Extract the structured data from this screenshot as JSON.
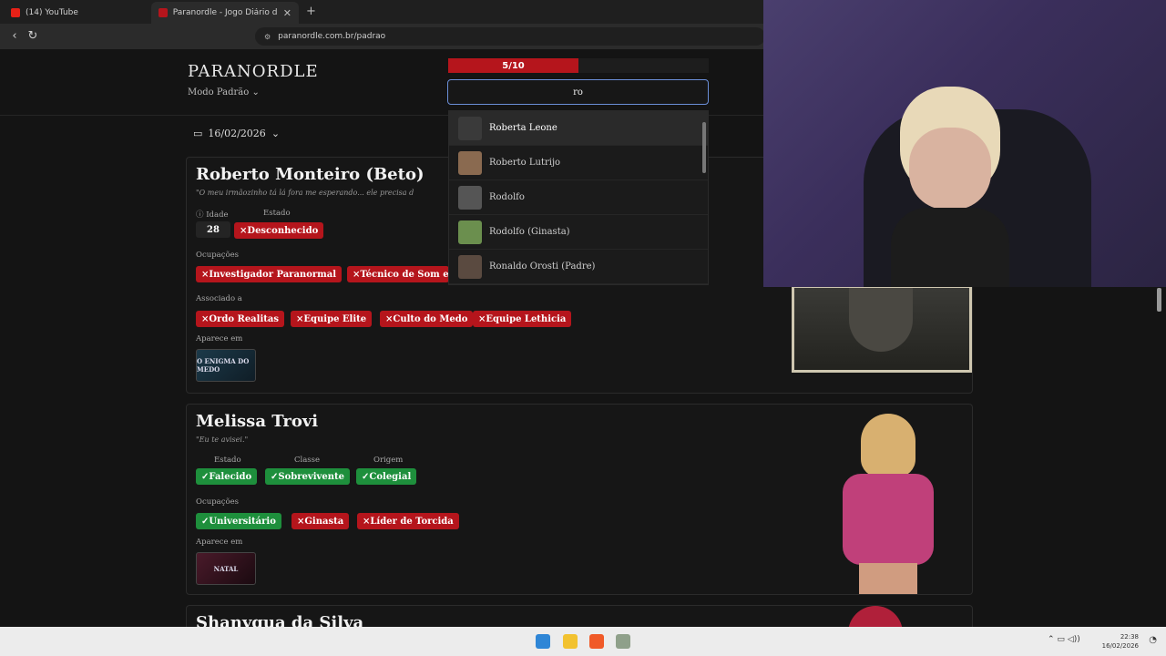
{
  "browser": {
    "tabs": [
      {
        "label": "(14) YouTube",
        "color": "#e62117"
      },
      {
        "label": "Paranordle - Jogo Diário de Ord",
        "color": "#b5151c"
      }
    ],
    "url": "paranordle.com.br/padrao"
  },
  "header": {
    "logo": "PARANORDLE",
    "mode": "Modo Padrão",
    "progress": {
      "label": "5/10",
      "fraction": 0.5
    },
    "guess_value": "ro",
    "date": "16/02/2026"
  },
  "dropdown": {
    "options": [
      {
        "name": "Roberta Leone",
        "avatar": "#3a3a3a"
      },
      {
        "name": "Roberto Lutrijo",
        "avatar": "#8a6a50"
      },
      {
        "name": "Rodolfo",
        "avatar": "#555555"
      },
      {
        "name": "Rodolfo (Ginasta)",
        "avatar": "#6b8f4e"
      },
      {
        "name": "Ronaldo Orosti (Padre)",
        "avatar": "#5a4a40"
      }
    ]
  },
  "cards": {
    "roberto": {
      "name": "Roberto Monteiro (Beto)",
      "quote": "\"O meu irmãozinho tá lá fora me esperando... ele precisa d",
      "idade_label": "Idade",
      "idade": "28",
      "estado_label": "Estado",
      "estado": "Desconhecido",
      "ocupacoes_label": "Ocupações",
      "ocupacoes": [
        "Investigador Paranormal",
        "Técnico de Som e A"
      ],
      "associado_label": "Associado a",
      "associado": [
        "Ordo Realitas",
        "Equipe Elite",
        "Culto do Medo",
        "Equipe Lethicia"
      ],
      "aparece_label": "Aparece em",
      "aparece_thumb": "O ENIGMA DO MEDO"
    },
    "melissa": {
      "name": "Melissa Trovi",
      "quote": "\"Eu te avisei.\"",
      "estado_label": "Estado",
      "classe_label": "Classe",
      "origem_label": "Origem",
      "estado": "Falecido",
      "classe": "Sobrevivente",
      "origem": "Colegial",
      "ocupacoes_label": "Ocupações",
      "ocupacoes": [
        {
          "label": "Universitário",
          "ok": true
        },
        {
          "label": "Ginasta",
          "ok": false
        },
        {
          "label": "Líder de Torcida",
          "ok": false
        }
      ],
      "aparece_label": "Aparece em",
      "aparece_thumb": "NATAL"
    },
    "next": {
      "name": "Shanyqua da Silva"
    }
  },
  "taskbar": {
    "time": "22:38",
    "date": "16/02/2026"
  }
}
